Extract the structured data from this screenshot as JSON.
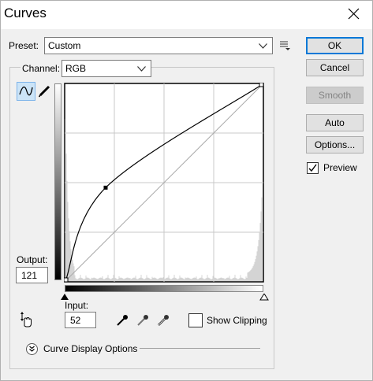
{
  "window": {
    "title": "Curves"
  },
  "preset": {
    "label": "Preset:",
    "value": "Custom"
  },
  "channel": {
    "label": "Channel:",
    "value": "RGB"
  },
  "buttons": {
    "ok": "OK",
    "cancel": "Cancel",
    "smooth": "Smooth",
    "auto": "Auto",
    "options": "Options...",
    "preview": "Preview"
  },
  "preview_checked": true,
  "output": {
    "label": "Output:",
    "value": "121"
  },
  "input": {
    "label": "Input:",
    "value": "52"
  },
  "show_clipping": {
    "label": "Show Clipping",
    "checked": false
  },
  "curve_display_options": "Curve Display Options",
  "curve_point": {
    "input": 52,
    "output": 121
  },
  "colors": {
    "ok_border": "#0078d7",
    "window_bg": "#f0f0f0"
  }
}
